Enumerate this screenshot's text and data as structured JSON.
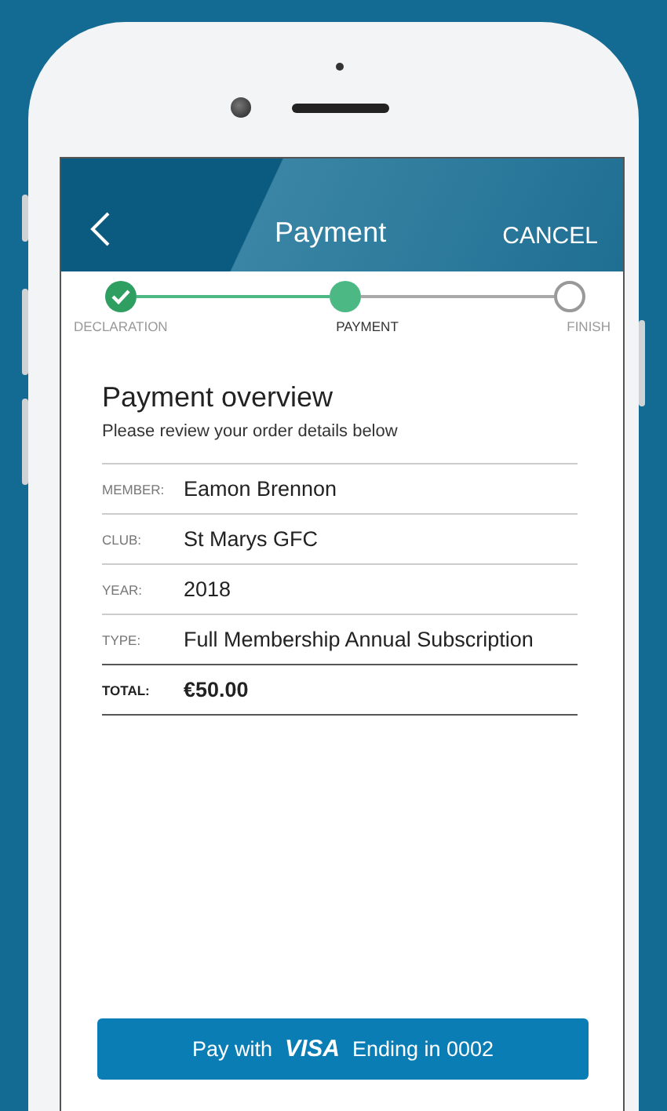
{
  "header": {
    "title": "Payment",
    "action": "CANCEL"
  },
  "steps": [
    {
      "label": "DECLARATION",
      "kind": "done"
    },
    {
      "label": "PAYMENT",
      "kind": "current"
    },
    {
      "label": "FINISH",
      "kind": "todo"
    }
  ],
  "overview": {
    "title": "Payment overview",
    "subtitle": "Please review your order details below"
  },
  "rows": [
    {
      "label": "MEMBER:",
      "value": "Eamon Brennon",
      "kind": "item"
    },
    {
      "label": "CLUB:",
      "value": "St Marys GFC",
      "kind": "item"
    },
    {
      "label": "YEAR:",
      "value": "2018",
      "kind": "item"
    },
    {
      "label": "TYPE:",
      "value": "Full Membership Annual Subscription",
      "kind": "item"
    },
    {
      "label": "TOTAL:",
      "value": "€50.00",
      "kind": "total"
    }
  ],
  "pay_button": {
    "prefix": "Pay with",
    "brand": "VISA",
    "suffix": "Ending in 0002"
  }
}
